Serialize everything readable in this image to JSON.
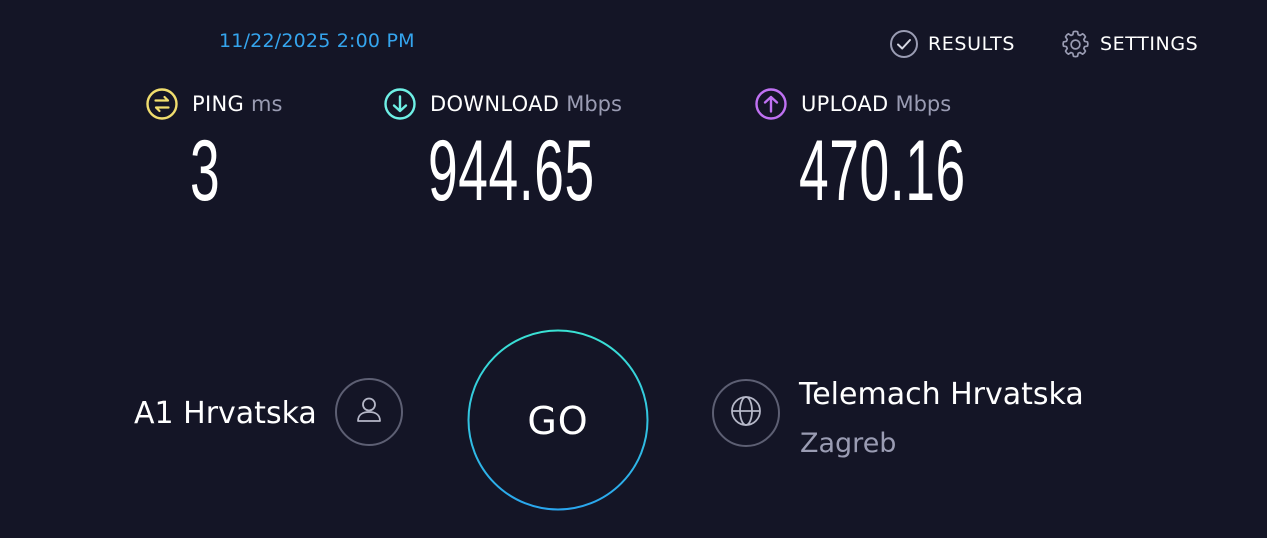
{
  "header": {
    "timestamp": "11/22/2025 2:00 PM",
    "results_label": "RESULTS",
    "settings_label": "SETTINGS"
  },
  "metrics": {
    "ping": {
      "label": "PING",
      "unit": "ms",
      "value": "3",
      "icon": "ping-icon",
      "color": "#f0dd6e"
    },
    "download": {
      "label": "DOWNLOAD",
      "unit": "Mbps",
      "value": "944.65",
      "icon": "download-arrow-icon",
      "color": "#6ff0e6"
    },
    "upload": {
      "label": "UPLOAD",
      "unit": "Mbps",
      "value": "470.16",
      "icon": "upload-arrow-icon",
      "color": "#bf71f2"
    }
  },
  "provider": {
    "isp_name": "A1 Hrvatska",
    "icon": "user-icon"
  },
  "go_button": {
    "label": "GO"
  },
  "server": {
    "name": "Telemach Hrvatska",
    "location": "Zagreb",
    "icon": "globe-icon"
  },
  "colors": {
    "background": "#141526",
    "accent_blue": "#35a5ee",
    "muted_text": "#9a9cb3"
  }
}
